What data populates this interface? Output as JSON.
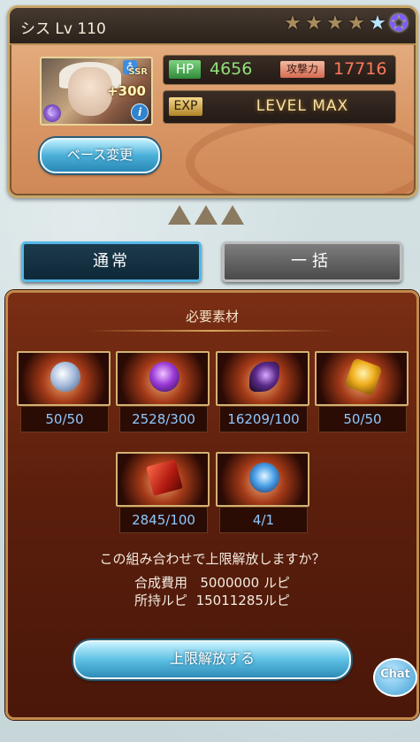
{
  "character": {
    "name": "シス",
    "level_text": "Lv 110",
    "rarity": "SSR",
    "plus_bonus": "+300",
    "hp_label": "HP",
    "hp_value": "4656",
    "attack_label": "攻撃力",
    "attack_value": "17716",
    "exp_label": "EXP",
    "exp_status": "LEVEL MAX",
    "star_count": 6,
    "stars_filled": 6,
    "star_icons": [
      "star-icon",
      "star-icon",
      "star-icon",
      "star-icon",
      "blue-star-icon",
      "purple-star-icon"
    ]
  },
  "buttons": {
    "base_change": "ベース変更",
    "normal": "通常",
    "bulk": "一括",
    "uncap": "上限解放する",
    "chat": "Chat"
  },
  "materials_panel": {
    "title": "必要素材",
    "materials": [
      {
        "icon": "crystal-sphere-icon",
        "count": "50/50"
      },
      {
        "icon": "dark-purple-crystal-icon",
        "count": "2528/300"
      },
      {
        "icon": "dark-horn-icon",
        "count": "16209/100"
      },
      {
        "icon": "golden-dice-icon",
        "count": "50/50"
      },
      {
        "icon": "red-scroll-icon",
        "count": "2845/100"
      },
      {
        "icon": "blue-spirit-icon",
        "count": "4/1"
      }
    ],
    "confirm_text": "この組み合わせで上限解放しますか？",
    "cost_label": "合成費用",
    "cost_value": "5000000 ルピ",
    "owned_label": "所持ルピ",
    "owned_value": "15011285ルピ"
  },
  "colors": {
    "accent_blue": "#4ab0d8",
    "panel_brown": "#5a1e0c",
    "count_text": "#8fc8ff"
  }
}
